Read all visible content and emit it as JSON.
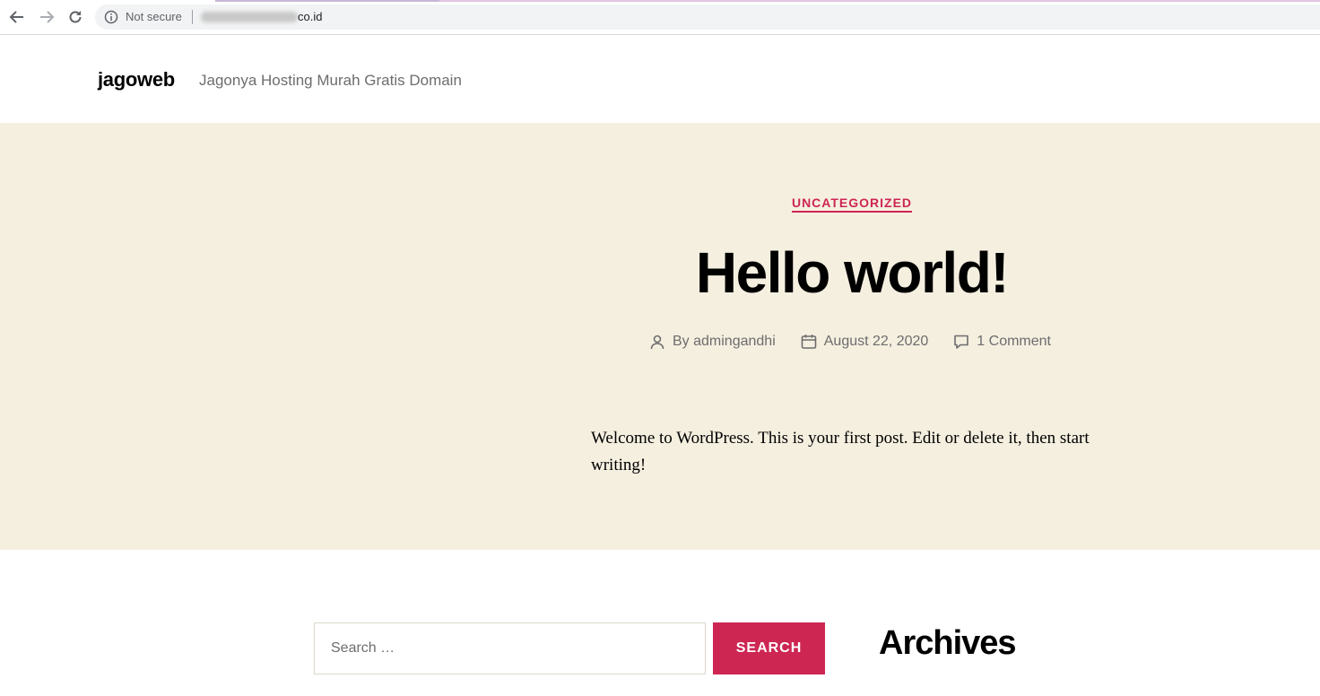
{
  "browser": {
    "security_label": "Not secure",
    "url_visible_tail": "co.id",
    "icons": [
      "back-arrow-icon",
      "forward-arrow-icon",
      "reload-icon",
      "info-icon"
    ]
  },
  "site": {
    "title": "jagoweb",
    "description": "Jagonya Hosting Murah Gratis Domain"
  },
  "post": {
    "category": "UNCATEGORIZED",
    "title": "Hello world!",
    "author": "By admingandhi",
    "date": "August 22, 2020",
    "comments": "1 Comment",
    "content": "Welcome to WordPress. This is your first post. Edit or delete it, then start writing!"
  },
  "widgets": {
    "search_placeholder": "Search …",
    "search_button": "SEARCH",
    "archives_title": "Archives"
  },
  "colors": {
    "accent": "#cd2653",
    "post_background": "#f5efe0",
    "meta_text": "#6d6d6d"
  }
}
